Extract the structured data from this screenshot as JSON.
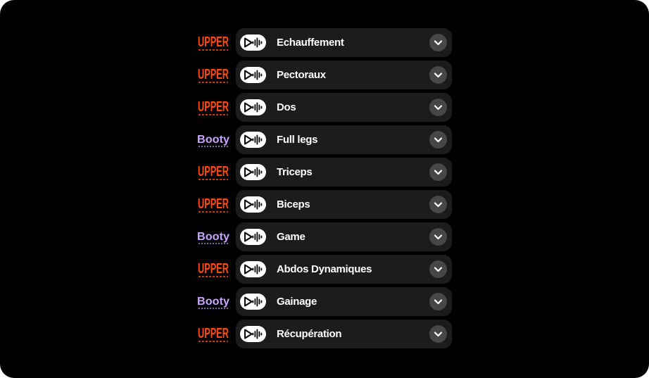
{
  "colors": {
    "background": "#000000",
    "row_background": "#1c1c1c",
    "upper_brand": "#ff4d12",
    "booty_brand": "#c8a6ff",
    "chevron_button": "#474747"
  },
  "brands": {
    "upper": "UPPER",
    "booty": "Booty"
  },
  "rows": [
    {
      "brand": "upper",
      "label": "Echauffement",
      "play_icon": "play-waveform-icon",
      "expand_icon": "chevron-down-icon"
    },
    {
      "brand": "upper",
      "label": "Pectoraux",
      "play_icon": "play-waveform-icon",
      "expand_icon": "chevron-down-icon"
    },
    {
      "brand": "upper",
      "label": "Dos",
      "play_icon": "play-waveform-icon",
      "expand_icon": "chevron-down-icon"
    },
    {
      "brand": "booty",
      "label": "Full legs",
      "play_icon": "play-waveform-icon",
      "expand_icon": "chevron-down-icon"
    },
    {
      "brand": "upper",
      "label": "Triceps",
      "play_icon": "play-waveform-icon",
      "expand_icon": "chevron-down-icon"
    },
    {
      "brand": "upper",
      "label": "Biceps",
      "play_icon": "play-waveform-icon",
      "expand_icon": "chevron-down-icon"
    },
    {
      "brand": "booty",
      "label": "Game",
      "play_icon": "play-waveform-icon",
      "expand_icon": "chevron-down-icon"
    },
    {
      "brand": "upper",
      "label": "Abdos Dynamiques",
      "play_icon": "play-waveform-icon",
      "expand_icon": "chevron-down-icon"
    },
    {
      "brand": "booty",
      "label": "Gainage",
      "play_icon": "play-waveform-icon",
      "expand_icon": "chevron-down-icon"
    },
    {
      "brand": "upper",
      "label": "Récupération",
      "play_icon": "play-waveform-icon",
      "expand_icon": "chevron-down-icon"
    }
  ]
}
